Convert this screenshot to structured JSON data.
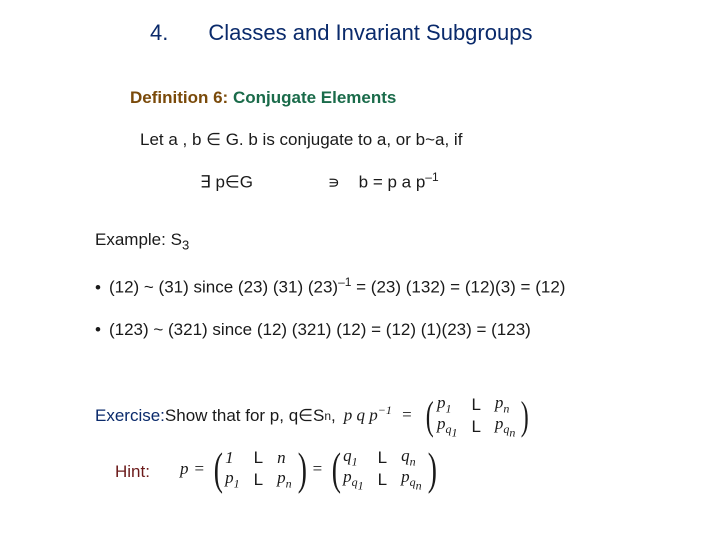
{
  "title": {
    "num": "4.",
    "text": "Classes and Invariant Subgroups"
  },
  "definition": {
    "label": "Definition 6:",
    "name": "Conjugate Elements"
  },
  "let_line": {
    "pre": "Let  a , b ",
    "in": "∈",
    "mid": " G.    b  is conjugate to  a, or  b~a,  if"
  },
  "exists_line": {
    "sym": "∃",
    "pg": "  p∈G",
    "ni": "∍",
    "eq": "b = p a p",
    "exp": "–1"
  },
  "example": {
    "label": "Example: S",
    "sub": "3"
  },
  "bullet1": {
    "dot": "•",
    "text": "(12) ~ (31)   since   (23) (31) (23)",
    "exp": "–1",
    "tail": " = (23) (132) = (12)(3) = (12)"
  },
  "bullet2": {
    "dot": "•",
    "text": "(123) ~ (321)  since  (12) (321) (12) = (12) (1)(23) = (123)"
  },
  "exercise": {
    "label": "Exercise:",
    "text": "  Show that for p, q  ",
    "in": "∈",
    "sn": " S",
    "nsub": "n",
    "comma": " ,",
    "pqp_lhs": "p q p",
    "pqp_exp": "−1",
    "eq": " = ",
    "m_r1c1": "p",
    "m_r1c1s": "1",
    "m_r1c2": "L",
    "m_r1c3": "p",
    "m_r1c3s": "n",
    "m_r2c1": "p",
    "m_r2c1s": "q",
    "m_r2c1s2": "1",
    "m_r2c2": "L",
    "m_r2c3": "p",
    "m_r2c3s": "q",
    "m_r2c3s2": "n"
  },
  "hint": {
    "label": "Hint:",
    "p_eq": "p",
    "eq": " = ",
    "a_r1c1": "1",
    "a_r1c2": "L",
    "a_r1c3": "n",
    "a_r2c1": "p",
    "a_r2c1s": "1",
    "a_r2c2": "L",
    "a_r2c3": "p",
    "a_r2c3s": "n",
    "eq2": " = ",
    "b_r1c1": "q",
    "b_r1c1s": "1",
    "b_r1c2": "L",
    "b_r1c3": "q",
    "b_r1c3s": "n",
    "b_r2c1": "p",
    "b_r2c1s": "q",
    "b_r2c1s2": "1",
    "b_r2c2": "L",
    "b_r2c3": "p",
    "b_r2c3s": "q",
    "b_r2c3s2": "n"
  }
}
